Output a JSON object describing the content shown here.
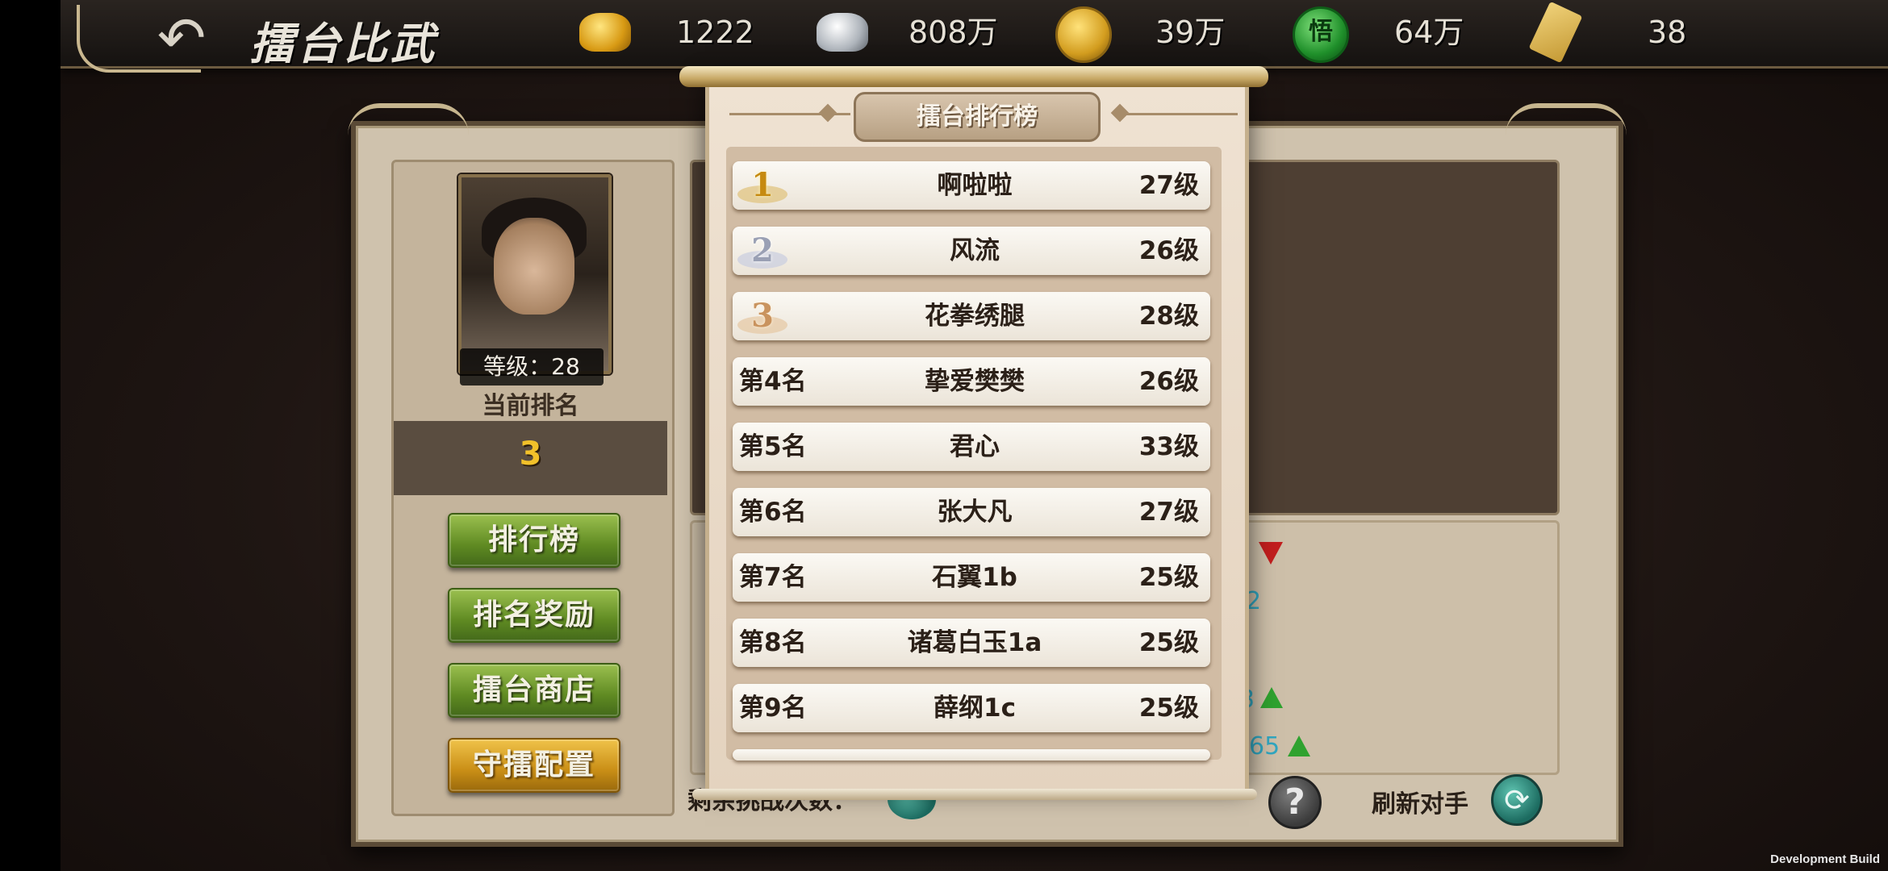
{
  "header": {
    "title": "擂台比武",
    "resources": [
      {
        "icon": "gold-ingot-icon",
        "value": "1222"
      },
      {
        "icon": "silver-ingot-icon",
        "value": "808万"
      },
      {
        "icon": "copper-coin-icon",
        "value": "39万"
      },
      {
        "icon": "enlightenment-jade-icon",
        "value": "64万",
        "glyph": "悟"
      },
      {
        "icon": "token-scroll-icon",
        "value": "38"
      }
    ]
  },
  "player": {
    "level_label": "等级：28",
    "rank_caption": "当前排名",
    "rank_value": "3"
  },
  "menu": {
    "leaderboard": "排行榜",
    "rank_rewards": "排名奖励",
    "arena_shop": "擂台商店",
    "defense_config": "守擂配置"
  },
  "background_panel": {
    "rank_change_a": "2",
    "rank_change_b": "3",
    "rank_change_c": "65",
    "remaining_label": "剩余挑战次数：",
    "refresh_label": "刷新对手",
    "help_glyph": "?",
    "refresh_glyph": "⟳"
  },
  "leaderboard": {
    "title": "擂台排行榜",
    "rows": [
      {
        "rank": "1",
        "name": "啊啦啦",
        "level": "27级",
        "medal": true
      },
      {
        "rank": "2",
        "name": "风流",
        "level": "26级",
        "medal": true
      },
      {
        "rank": "3",
        "name": "花拳绣腿",
        "level": "28级",
        "medal": true
      },
      {
        "rank": "第4名",
        "name": "挚爱樊樊",
        "level": "26级"
      },
      {
        "rank": "第5名",
        "name": "君心",
        "level": "33级"
      },
      {
        "rank": "第6名",
        "name": "张大凡",
        "level": "27级"
      },
      {
        "rank": "第7名",
        "name": "石翼1b",
        "level": "25级"
      },
      {
        "rank": "第8名",
        "name": "诸葛白玉1a",
        "level": "25级"
      },
      {
        "rank": "第9名",
        "name": "薛纲1c",
        "level": "25级"
      }
    ]
  },
  "footer": {
    "build_tag": "Development Build"
  },
  "colors": {
    "accent_gold": "#f2c12a",
    "button_green": "#5f8a22",
    "button_gold": "#c98e16",
    "down_arrow": "#c21e1e",
    "up_arrow": "#2fa22f"
  }
}
